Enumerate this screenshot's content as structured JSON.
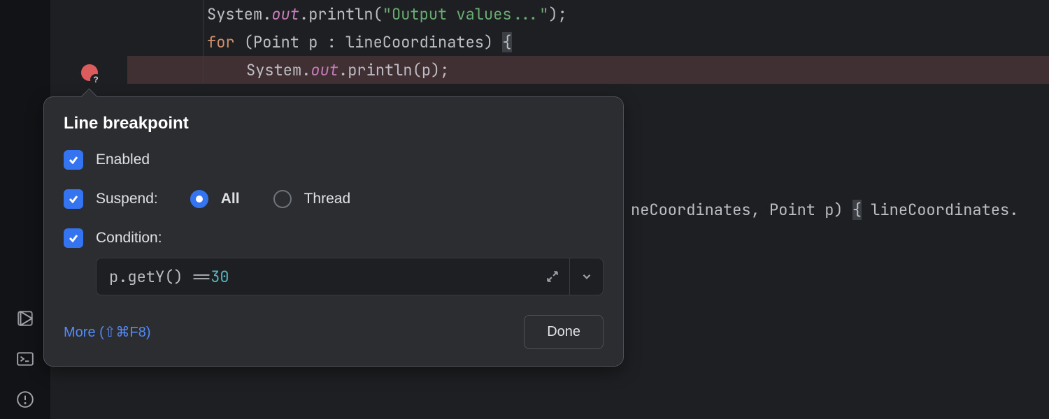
{
  "code": {
    "line1_indent": "        ",
    "line1_a": "System.",
    "line1_out": "out",
    "line1_b": ".println(",
    "line1_str": "\"Output values...\"",
    "line1_c": ");",
    "line2_indent": "        ",
    "line2_for": "for",
    "line2_a": " (Point p : lineCoordinates) ",
    "line2_brace": "{",
    "line3_indent": "            ",
    "line3_a": "System.",
    "line3_out": "out",
    "line3_b": ".println(p);",
    "line7_a": "neCoordinates, Point p) ",
    "line7_brace": "{",
    "line7_b": " lineCoordinates."
  },
  "popup": {
    "title": "Line breakpoint",
    "enabled_label": "Enabled",
    "suspend_label": "Suspend:",
    "radio_all": "All",
    "radio_thread": "Thread",
    "condition_label": "Condition:",
    "condition_expr_a": "p.getY() == ",
    "condition_expr_num": "30",
    "more_label": "More (⇧⌘F8)",
    "done_label": "Done"
  },
  "icons": {
    "breakpoint_badge": "?"
  }
}
